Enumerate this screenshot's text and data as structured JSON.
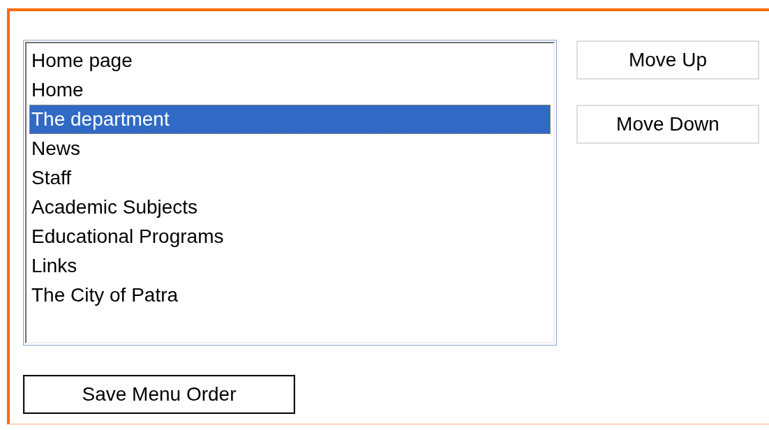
{
  "menu_list": {
    "items": [
      {
        "label": "Home page",
        "selected": false
      },
      {
        "label": "Home",
        "selected": false
      },
      {
        "label": "The department",
        "selected": true
      },
      {
        "label": "News",
        "selected": false
      },
      {
        "label": "Staff",
        "selected": false
      },
      {
        "label": "Academic Subjects",
        "selected": false
      },
      {
        "label": "Educational Programs",
        "selected": false
      },
      {
        "label": "Links",
        "selected": false
      },
      {
        "label": "The City of Patra",
        "selected": false
      }
    ]
  },
  "side_buttons": [
    "Move Up",
    "Move Down"
  ],
  "save_button": "Save Menu Order"
}
